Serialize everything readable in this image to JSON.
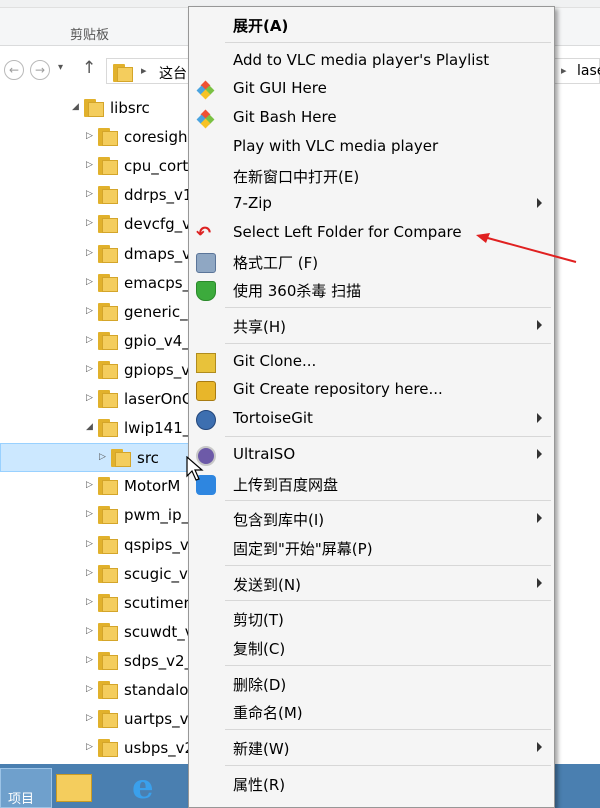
{
  "ribbon": {
    "group_label": "剪贴板"
  },
  "address_bar": {
    "path_start": "这台",
    "path_end": "lase"
  },
  "tree": {
    "items": [
      {
        "label": "libsrc",
        "expand": "◢",
        "indent": 0
      },
      {
        "label": "coresigh",
        "expand": "▷",
        "indent": 1
      },
      {
        "label": "cpu_cort",
        "expand": "▷",
        "indent": 1
      },
      {
        "label": "ddrps_v1",
        "expand": "▷",
        "indent": 1
      },
      {
        "label": "devcfg_v",
        "expand": "▷",
        "indent": 1
      },
      {
        "label": "dmaps_v",
        "expand": "▷",
        "indent": 1
      },
      {
        "label": "emacps_",
        "expand": "▷",
        "indent": 1
      },
      {
        "label": "generic_",
        "expand": "▷",
        "indent": 1
      },
      {
        "label": "gpio_v4_",
        "expand": "▷",
        "indent": 1
      },
      {
        "label": "gpiops_v",
        "expand": "▷",
        "indent": 1
      },
      {
        "label": "laserOnC",
        "expand": "▷",
        "indent": 1
      },
      {
        "label": "lwip141_",
        "expand": "◢",
        "indent": 1
      },
      {
        "label": "src",
        "expand": "▷",
        "indent": 2,
        "selected": true
      },
      {
        "label": "MotorM",
        "expand": "▷",
        "indent": 1
      },
      {
        "label": "pwm_ip_",
        "expand": "▷",
        "indent": 1
      },
      {
        "label": "qspips_v",
        "expand": "▷",
        "indent": 1
      },
      {
        "label": "scugic_v",
        "expand": "▷",
        "indent": 1
      },
      {
        "label": "scutimer",
        "expand": "▷",
        "indent": 1
      },
      {
        "label": "scuwdt_v",
        "expand": "▷",
        "indent": 1
      },
      {
        "label": "sdps_v2_",
        "expand": "▷",
        "indent": 1
      },
      {
        "label": "standalo",
        "expand": "▷",
        "indent": 1
      },
      {
        "label": "uartps_v",
        "expand": "▷",
        "indent": 1
      },
      {
        "label": "usbps_v2",
        "expand": "▷",
        "indent": 1
      }
    ]
  },
  "taskbar": {
    "partial_text": "项目"
  },
  "context_menu": {
    "items": [
      {
        "label": "展开(A)",
        "bold": true
      },
      {
        "sep": true
      },
      {
        "label": "Add to VLC media player's Playlist"
      },
      {
        "label": "Git GUI Here",
        "icon": "git-gui-icon"
      },
      {
        "label": "Git Bash Here",
        "icon": "git-bash-icon"
      },
      {
        "label": "Play with VLC media player"
      },
      {
        "label": "在新窗口中打开(E)"
      },
      {
        "label": "7-Zip",
        "submenu": true
      },
      {
        "label": "Select Left Folder for Compare",
        "icon": "undo-arrow-icon"
      },
      {
        "label": "格式工厂 (F)",
        "icon": "format-factory-icon"
      },
      {
        "label": "使用 360杀毒 扫描",
        "icon": "360-shield-icon"
      },
      {
        "sep": true
      },
      {
        "label": "共享(H)",
        "submenu": true
      },
      {
        "sep": true
      },
      {
        "label": "Git Clone...",
        "icon": "git-clone-icon"
      },
      {
        "label": "Git Create repository here...",
        "icon": "git-create-icon"
      },
      {
        "label": "TortoiseGit",
        "icon": "tortoisegit-icon",
        "submenu": true
      },
      {
        "sep": true
      },
      {
        "label": "UltraISO",
        "icon": "ultraiso-icon",
        "submenu": true
      },
      {
        "label": "上传到百度网盘",
        "icon": "baidu-cloud-icon"
      },
      {
        "sep": true
      },
      {
        "label": "包含到库中(I)",
        "submenu": true
      },
      {
        "label": "固定到\"开始\"屏幕(P)"
      },
      {
        "sep": true
      },
      {
        "label": "发送到(N)",
        "submenu": true
      },
      {
        "sep": true
      },
      {
        "label": "剪切(T)"
      },
      {
        "label": "复制(C)"
      },
      {
        "sep": true
      },
      {
        "label": "删除(D)"
      },
      {
        "label": "重命名(M)"
      },
      {
        "sep": true
      },
      {
        "label": "新建(W)",
        "submenu": true
      },
      {
        "sep": true
      },
      {
        "label": "属性(R)"
      }
    ]
  },
  "colors": {
    "annotation_arrow": "#e02020",
    "selection_bg": "#cce8ff",
    "menu_bg": "#f5f5f5"
  }
}
